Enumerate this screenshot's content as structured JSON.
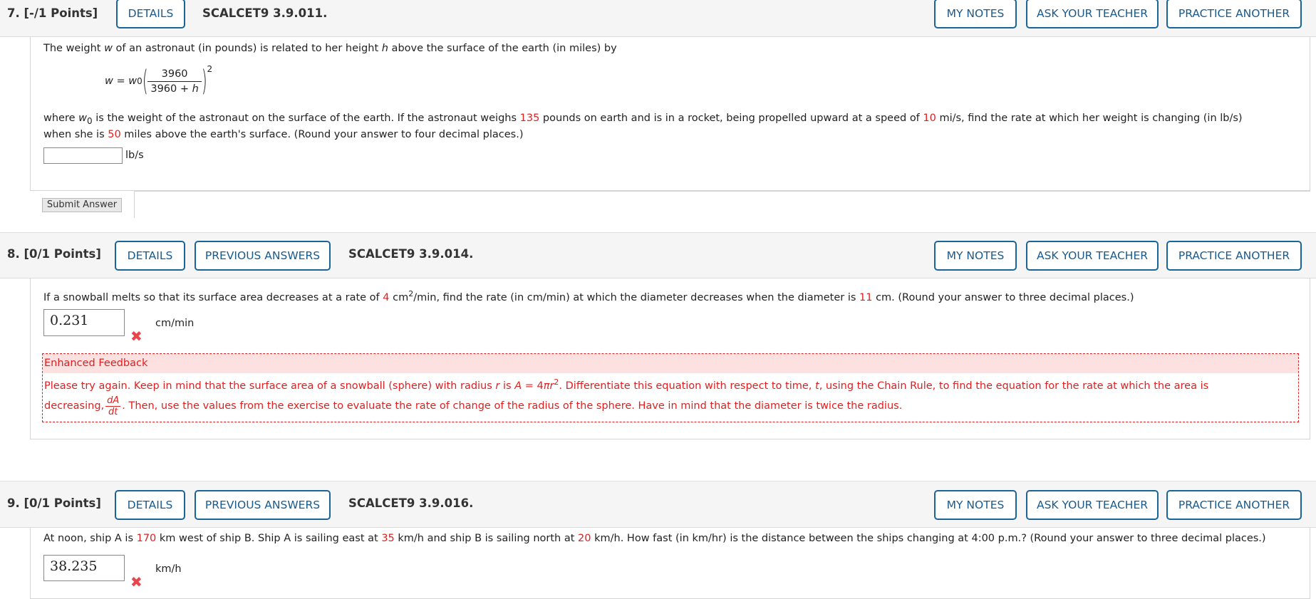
{
  "buttons": {
    "details": "DETAILS",
    "previous_answers": "PREVIOUS ANSWERS",
    "my_notes": "MY NOTES",
    "ask_teacher": "ASK YOUR TEACHER",
    "practice_another": "PRACTICE ANOTHER",
    "submit": "Submit Answer"
  },
  "q7": {
    "number": "7.",
    "points": "[-/1 Points]",
    "code": "SCALCET9 3.9.011.",
    "intro": [
      "The weight ",
      "w",
      " of an astronaut (in pounds) is related to her height ",
      "h",
      " above the surface of the earth (in miles) by"
    ],
    "formula": {
      "lhs": "w = w",
      "sub": "0",
      "num": "3960",
      "den": "3960 + ",
      "den_var": "h",
      "exp": "2"
    },
    "line2": [
      "where ",
      "w",
      "0",
      " is the weight of the astronaut on the surface of the earth. If the astronaut weighs ",
      "135",
      " pounds on earth and is in a rocket, being propelled upward at a speed of ",
      "10",
      " mi/s, find the rate at which her weight is changing (in lb/s)"
    ],
    "line3": [
      "when she is ",
      "50",
      " miles above the earth's surface. (Round your answer to four decimal places.)"
    ],
    "answer": "",
    "unit": "lb/s"
  },
  "q8": {
    "number": "8.",
    "points": "[0/1 Points]",
    "code": "SCALCET9 3.9.014.",
    "text": [
      "If a snowball melts so that its surface area decreases at a rate of ",
      "4",
      " cm",
      "2",
      "/min, find the rate (in cm/min) at which the diameter decreases when the diameter is ",
      "11",
      " cm. (Round your answer to three decimal places.)"
    ],
    "answer": "0.231",
    "unit": "cm/min",
    "status": "incorrect",
    "feedback": {
      "title": "Enhanced Feedback",
      "line1": [
        "Please try again. Keep in mind that the surface area of a snowball (sphere) with radius ",
        "r",
        " is ",
        "A",
        " = 4",
        "πr",
        "2",
        ". Differentiate this equation with respect to time, ",
        "t",
        ", using the Chain Rule, to find the equation for the rate at which the area is"
      ],
      "line2": [
        "decreasing, ",
        "dA",
        "dt",
        ". Then, use the values from the exercise to evaluate the rate of change of the radius of the sphere. Have in mind that the diameter is twice the radius."
      ]
    }
  },
  "q9": {
    "number": "9.",
    "points": "[0/1 Points]",
    "code": "SCALCET9 3.9.016.",
    "text": [
      "At noon, ship A is ",
      "170",
      " km west of ship B. Ship A is sailing east at ",
      "35",
      " km/h and ship B is sailing north at ",
      "20",
      " km/h. How fast (in km/hr) is the distance between the ships changing at 4:00 p.m.? (Round your answer to three decimal places.)"
    ],
    "answer": "38.235",
    "unit": "km/h",
    "status": "incorrect"
  },
  "colors": {
    "accent": "#1a6496",
    "highlight": "#e02020",
    "feedback_bg": "#fde0e0"
  },
  "icons": {
    "incorrect": "x-mark-icon"
  }
}
